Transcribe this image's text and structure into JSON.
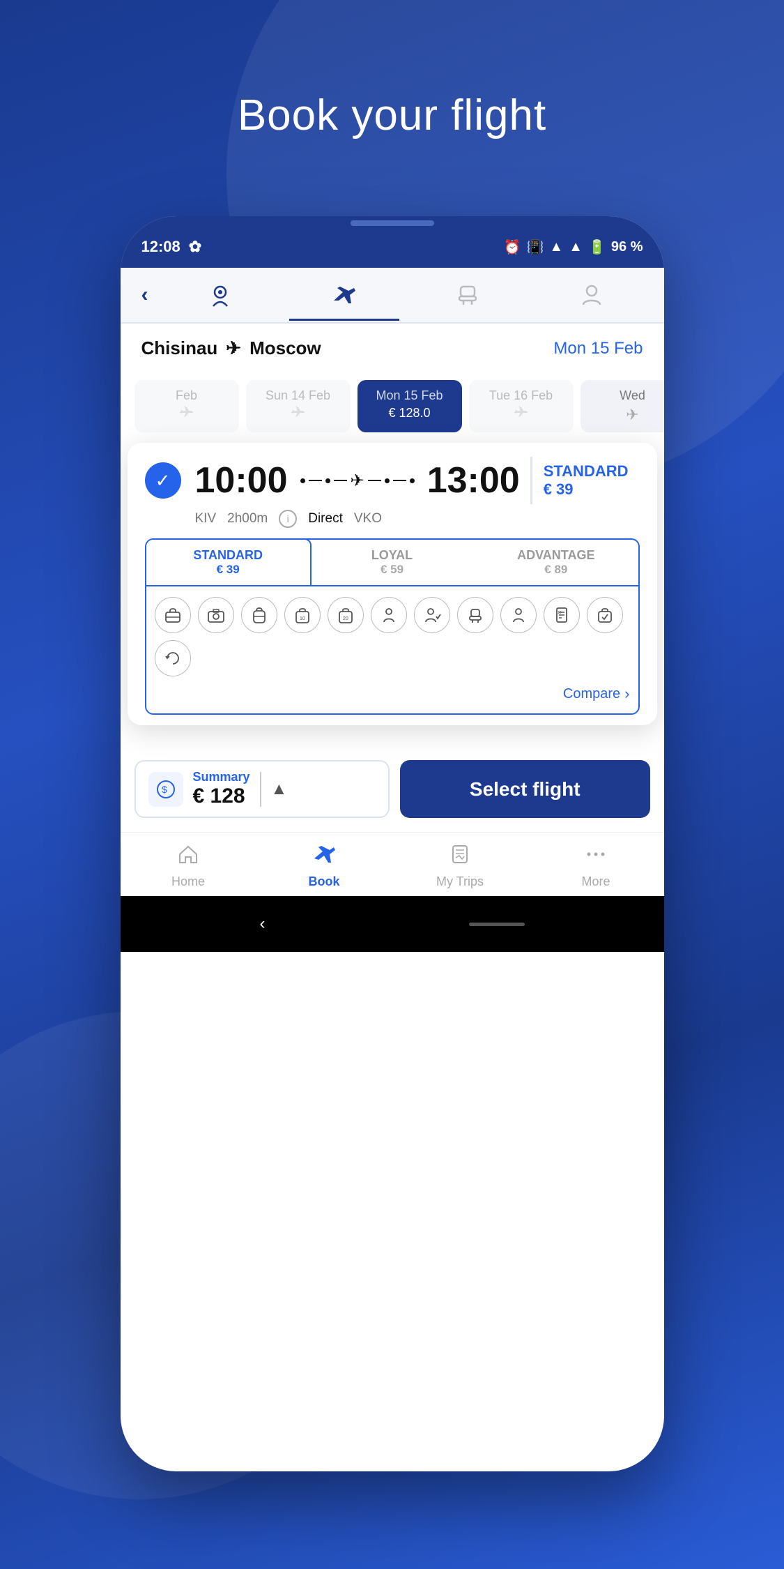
{
  "page": {
    "title": "Book your flight"
  },
  "statusBar": {
    "time": "12:08",
    "battery": "96 %"
  },
  "navTabs": [
    {
      "id": "back",
      "label": "back"
    },
    {
      "id": "destination",
      "label": "destination",
      "active": false
    },
    {
      "id": "flight",
      "label": "flight",
      "active": true
    },
    {
      "id": "seat",
      "label": "seat",
      "active": false
    },
    {
      "id": "passenger",
      "label": "passenger",
      "active": false
    }
  ],
  "route": {
    "from": "Chisinau",
    "to": "Moscow",
    "date": "Mon 15 Feb"
  },
  "dates": [
    {
      "label": "Feb",
      "name": "",
      "hasFlight": false,
      "price": ""
    },
    {
      "label": "Sun 14 Feb",
      "name": "",
      "hasFlight": false,
      "price": ""
    },
    {
      "label": "Mon 15 Feb",
      "name": "",
      "hasFlight": true,
      "price": "€ 128.0",
      "selected": true
    },
    {
      "label": "Tue 16 Feb",
      "name": "",
      "hasFlight": false,
      "price": ""
    },
    {
      "label": "Wed",
      "name": "",
      "hasFlight": true,
      "price": ""
    }
  ],
  "flight": {
    "departTime": "10:00",
    "arriveTime": "13:00",
    "fromCode": "KIV",
    "toCode": "VKO",
    "duration": "2h00m",
    "type": "Direct",
    "selected": true
  },
  "tiers": [
    {
      "id": "standard",
      "name": "STANDARD",
      "price": "€ 39",
      "active": true
    },
    {
      "id": "loyal",
      "name": "LOYAL",
      "price": "€ 59",
      "active": false
    },
    {
      "id": "advantage",
      "name": "ADVANTAGE",
      "price": "€ 89",
      "active": false
    }
  ],
  "amenities": [
    "🧳",
    "📷",
    "🎒",
    "🗂️",
    "📦",
    "👔",
    "👤",
    "💺",
    "👤",
    "🗂️",
    "📋",
    "🔄"
  ],
  "compare": "Compare",
  "summary": {
    "label": "Summary",
    "amount": "€ 128"
  },
  "selectButton": "Select flight",
  "bottomNav": [
    {
      "id": "home",
      "label": "Home",
      "active": false
    },
    {
      "id": "book",
      "label": "Book",
      "active": true
    },
    {
      "id": "mytrips",
      "label": "My Trips",
      "active": false
    },
    {
      "id": "more",
      "label": "More",
      "active": false
    }
  ]
}
